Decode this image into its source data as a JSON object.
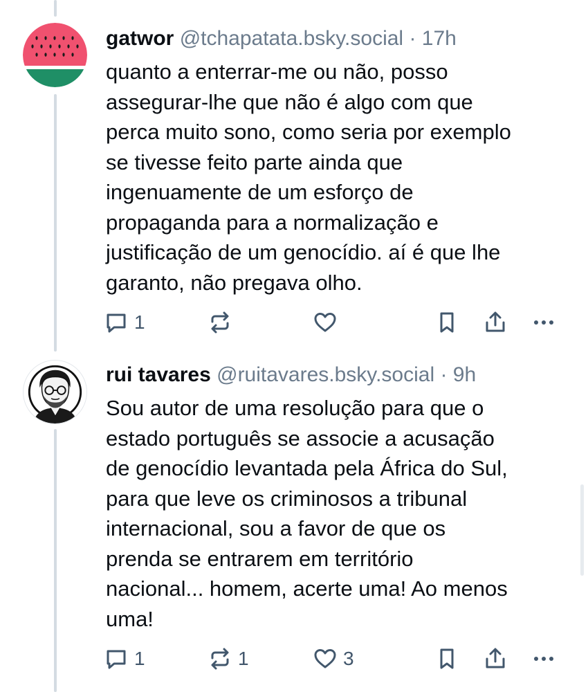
{
  "posts": [
    {
      "display_name": "gatwor",
      "handle": "@tchapatata.bsky.social",
      "separator": "·",
      "time": "17h",
      "avatar_icon": "watermelon-avatar",
      "text": "quanto a enterrar-me ou não, posso\nassegurar-lhe que não é algo com que\nperca muito sono, como seria por exemplo\nse tivesse feito parte ainda que\ningenuamente de um esforço de\npropaganda para a normalização e\njustificação de um genocídio. aí é que lhe\ngaranto, não pregava olho.",
      "reply_count": "1",
      "repost_count": "",
      "like_count": ""
    },
    {
      "display_name": "rui tavares",
      "handle": "@ruitavares.bsky.social",
      "separator": "·",
      "time": "9h",
      "avatar_icon": "portrait-avatar",
      "text": "Sou autor de uma resolução para que o\nestado português se associe a acusação\nde genocídio levantada pela África do Sul,\npara que leve os criminosos a tribunal\ninternacional, sou a favor de que os\nprenda se entrarem em território\nnacional... homem, acerte uma! Ao menos\numa!",
      "reply_count": "1",
      "repost_count": "1",
      "like_count": "3"
    }
  ],
  "icons": {
    "reply": "reply-icon",
    "repost": "repost-icon",
    "like": "heart-icon",
    "bookmark": "bookmark-icon",
    "share": "share-icon",
    "more": "more-icon"
  },
  "colors": {
    "text": "#0b0f14",
    "muted": "#6b7b8c",
    "action_icon": "#42576c",
    "thread_line": "#d4dbe2",
    "watermelon_flesh": "#f0516f",
    "watermelon_rind": "#1f8f66"
  }
}
